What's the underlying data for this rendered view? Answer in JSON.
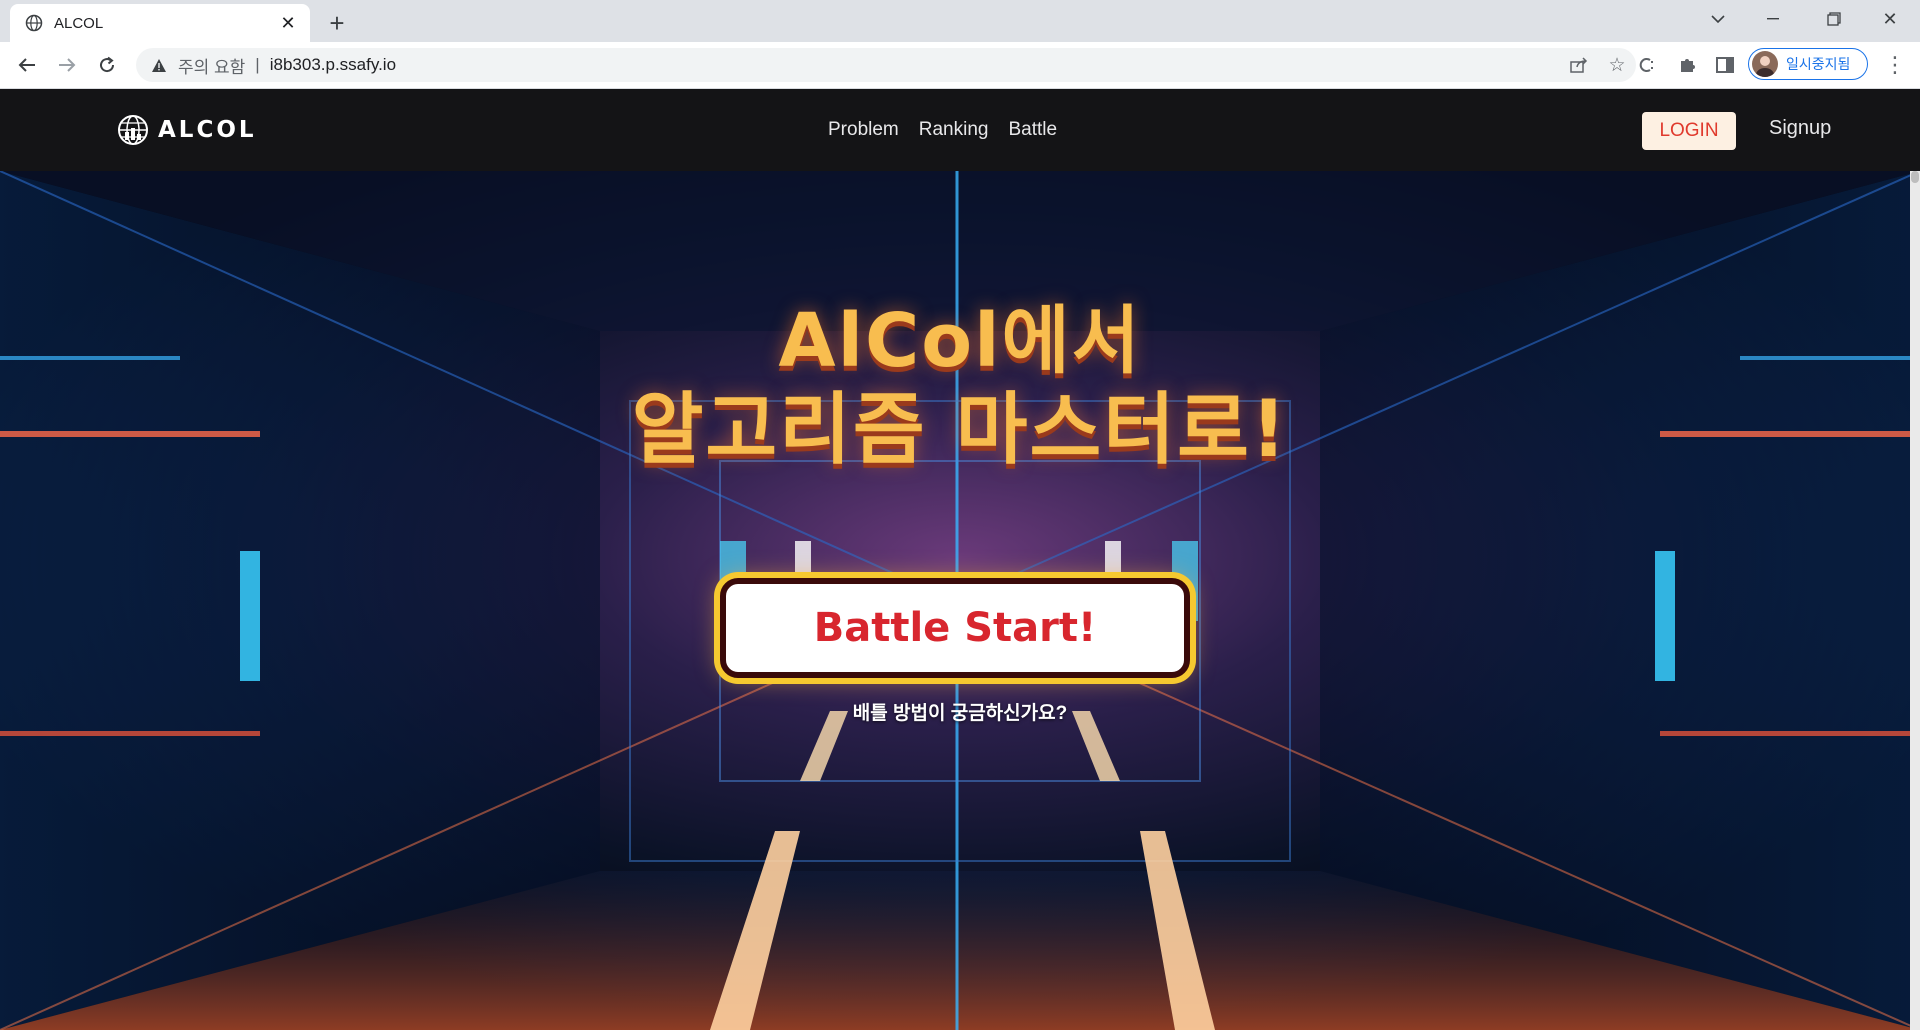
{
  "browser": {
    "tab_title": "ALCOL",
    "security_warning": "주의 요함",
    "url": "i8b303.p.ssafy.io",
    "profile_label": "일시중지됨"
  },
  "site": {
    "logo_text": "ALCOL",
    "nav": [
      {
        "label": "Problem"
      },
      {
        "label": "Ranking"
      },
      {
        "label": "Battle"
      }
    ],
    "login_label": "LOGIN",
    "signup_label": "Signup"
  },
  "hero": {
    "headline_line1": "AlCol에서",
    "headline_line2": "알고리즘 마스터로!",
    "battle_button": "Battle Start!",
    "howto_link": "배틀 방법이 궁금하신가요?"
  },
  "colors": {
    "accent_yellow": "#f8bd4f",
    "battle_red": "#d8262e",
    "nav_bg": "#141416",
    "login_bg": "#fdf0e2"
  }
}
